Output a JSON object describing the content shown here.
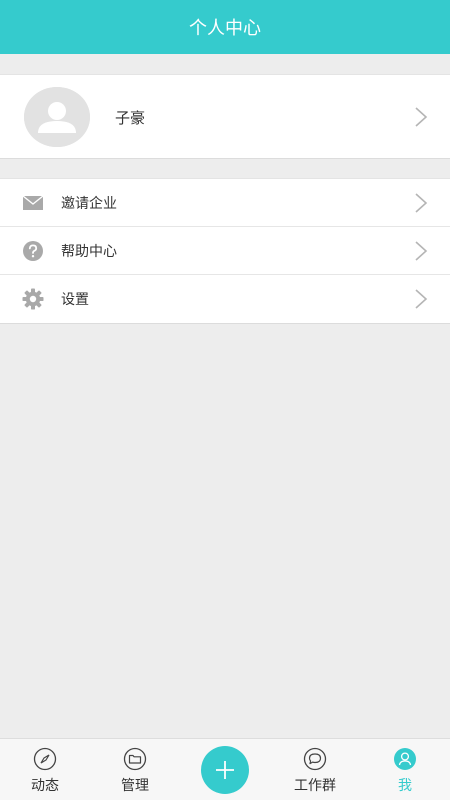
{
  "header": {
    "title": "个人中心"
  },
  "profile": {
    "name": "子豪",
    "avatar_icon": "avatar-placeholder-icon"
  },
  "menu": {
    "items": [
      {
        "label": "邀请企业",
        "icon": "mail-icon"
      },
      {
        "label": "帮助中心",
        "icon": "help-icon"
      },
      {
        "label": "设置",
        "icon": "gear-icon"
      }
    ]
  },
  "tabbar": {
    "tabs": [
      {
        "label": "动态",
        "icon": "compass-icon"
      },
      {
        "label": "管理",
        "icon": "folder-icon"
      },
      {
        "label": "工作群",
        "icon": "chat-bubble-icon"
      },
      {
        "label": "我",
        "icon": "user-icon",
        "active": true
      }
    ],
    "add_icon": "plus-icon"
  },
  "colors": {
    "accent": "#35cbcd",
    "background": "#ededed"
  }
}
